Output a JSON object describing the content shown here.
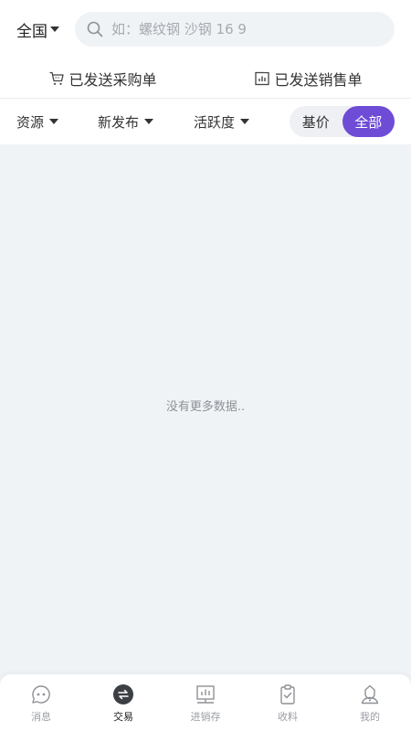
{
  "header": {
    "region": "全国",
    "search_placeholder": "如：螺纹钢 沙钢 16 9"
  },
  "sent_links": [
    {
      "label": "已发送采购单",
      "icon": "cart-icon"
    },
    {
      "label": "已发送销售单",
      "icon": "chart-icon"
    }
  ],
  "filters": [
    {
      "label": "资源"
    },
    {
      "label": "新发布"
    },
    {
      "label": "活跃度"
    }
  ],
  "toggle": {
    "options": [
      "基价",
      "全部"
    ],
    "active": "全部"
  },
  "empty_message": "没有更多数据..",
  "tabbar": {
    "items": [
      {
        "label": "消息",
        "icon": "message-icon"
      },
      {
        "label": "交易",
        "icon": "trade-icon"
      },
      {
        "label": "进销存",
        "icon": "inventory-icon"
      },
      {
        "label": "收料",
        "icon": "clipboard-icon"
      },
      {
        "label": "我的",
        "icon": "user-icon"
      }
    ],
    "active": "交易"
  },
  "colors": {
    "accent": "#6e4cd6",
    "background": "#f0f3f6"
  }
}
